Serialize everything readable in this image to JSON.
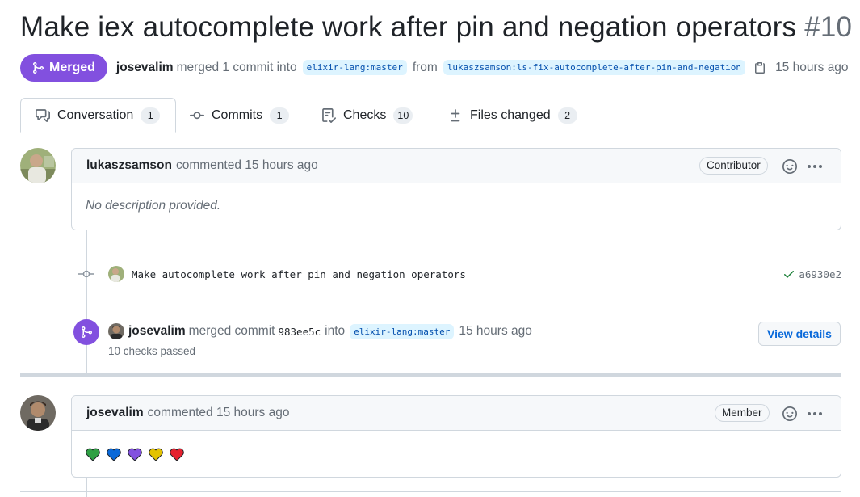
{
  "pr": {
    "title": "Make iex autocomplete work after pin and negation operators",
    "number": "#10"
  },
  "meta": {
    "status": "Merged",
    "author": "josevalim",
    "action": "merged 1 commit into",
    "base_branch": "elixir-lang:master",
    "from": "from",
    "head_branch": "lukaszsamson:ls-fix-autocomplete-after-pin-and-negation",
    "time": "15 hours ago"
  },
  "tabs": [
    {
      "label": "Conversation",
      "count": "1",
      "icon": "comment-discussion-icon"
    },
    {
      "label": "Commits",
      "count": "1",
      "icon": "git-commit-icon"
    },
    {
      "label": "Checks",
      "count": "10",
      "icon": "checklist-icon"
    },
    {
      "label": "Files changed",
      "count": "2",
      "icon": "diff-icon"
    }
  ],
  "comment1": {
    "author": "lukaszsamson",
    "action": "commented",
    "time": "15 hours ago",
    "role": "Contributor",
    "body": "No description provided."
  },
  "commit": {
    "message": "Make autocomplete work after pin and negation operators",
    "sha": "a6930e2",
    "status_color": "#1a7f37"
  },
  "merge_event": {
    "author": "josevalim",
    "action": "merged commit",
    "sha": "983ee5c",
    "into": "into",
    "branch": "elixir-lang:master",
    "time": "15 hours ago",
    "checks": "10 checks passed",
    "button": "View details"
  },
  "comment2": {
    "author": "josevalim",
    "action": "commented",
    "time": "15 hours ago",
    "role": "Member",
    "hearts": [
      {
        "color": "#2ea043",
        "icon": "green-heart-icon"
      },
      {
        "color": "#0969da",
        "icon": "blue-heart-icon"
      },
      {
        "color": "#8250df",
        "icon": "purple-heart-icon"
      },
      {
        "color": "#e3c200",
        "icon": "yellow-heart-icon"
      },
      {
        "color": "#e5212f",
        "icon": "red-heart-icon"
      }
    ]
  },
  "colors": {
    "merged": "#8250df",
    "link": "#0969da",
    "muted": "#656d76",
    "border": "#d0d7de"
  }
}
